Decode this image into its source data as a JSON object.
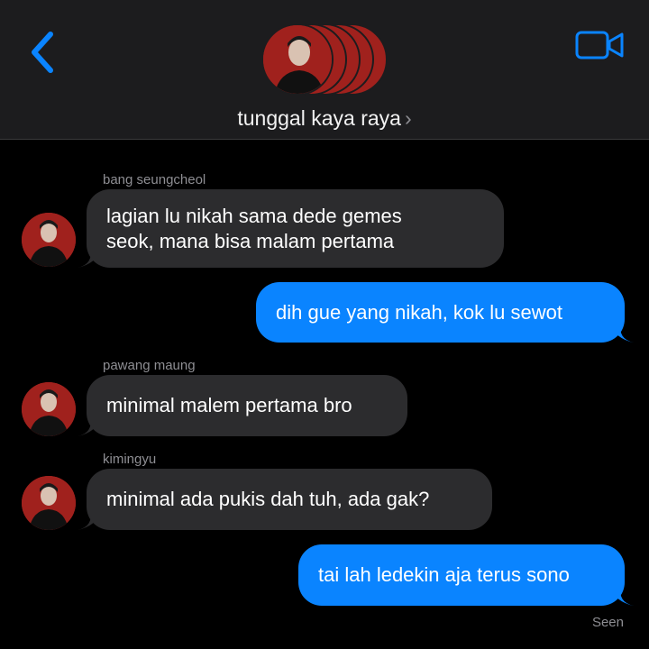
{
  "header": {
    "group_name": "tunggal kaya raya",
    "chevron": "›",
    "back_icon": "chevron-left-icon",
    "video_icon": "video-camera-icon",
    "accent": "#0a84ff"
  },
  "messages": [
    {
      "sender": "bang seungcheol",
      "direction": "incoming",
      "lines": [
        "lagian lu nikah sama dede gemes",
        "seok, mana bisa malam pertama"
      ]
    },
    {
      "direction": "outgoing",
      "text": "dih gue yang nikah, kok lu sewot"
    },
    {
      "sender": "pawang maung",
      "direction": "incoming",
      "text": "minimal malem pertama bro"
    },
    {
      "sender": "kimingyu",
      "direction": "incoming",
      "text": "minimal ada pukis dah tuh, ada gak?"
    },
    {
      "direction": "outgoing",
      "text": "tai lah ledekin aja terus sono"
    }
  ],
  "status": {
    "seen": "Seen"
  }
}
